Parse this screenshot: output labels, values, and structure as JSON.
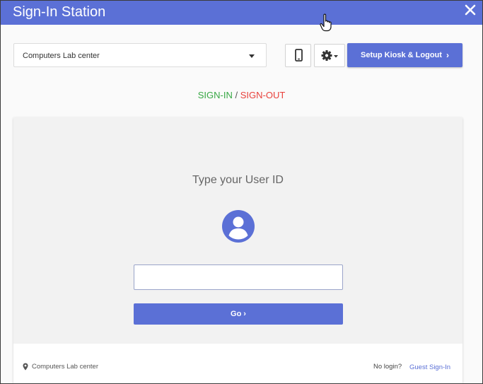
{
  "window": {
    "title": "Sign-In Station"
  },
  "toolbar": {
    "location_select": "Computers Lab center",
    "setup_button": "Setup Kiosk & Logout",
    "setup_chevron": "›"
  },
  "mode": {
    "sign_in": "SIGN-IN",
    "separator": "/",
    "sign_out": "SIGN-OUT"
  },
  "card": {
    "prompt": "Type your User ID",
    "user_id_value": "",
    "go_button": "Go",
    "go_chevron": "›"
  },
  "footer": {
    "location": "Computers Lab center",
    "no_login": "No login?",
    "guest_sign_in": "Guest Sign-In"
  },
  "colors": {
    "accent": "#5b70d6",
    "sign_in": "#37a844",
    "sign_out": "#e8403b"
  },
  "icons": [
    "close-icon",
    "mobile-icon",
    "gear-icon",
    "user-avatar-icon",
    "location-pin-icon",
    "hand-cursor-icon"
  ]
}
